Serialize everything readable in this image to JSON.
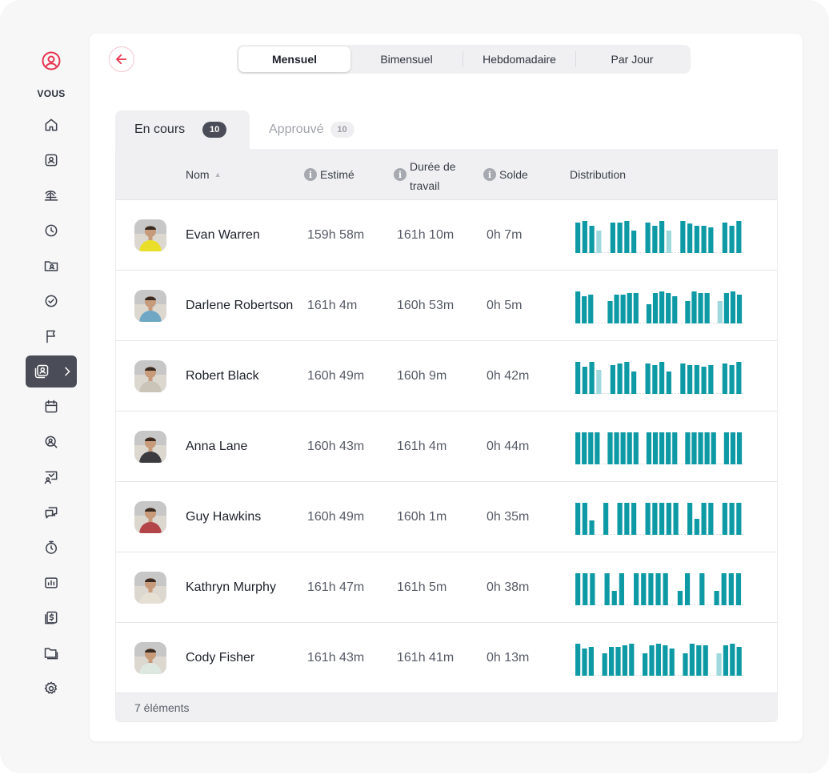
{
  "sidebar": {
    "me_label": "VOUS",
    "items": [
      {
        "icon": "home-icon"
      },
      {
        "icon": "user-card-icon"
      },
      {
        "icon": "beach-icon"
      },
      {
        "icon": "clock-icon"
      },
      {
        "icon": "folder-user-icon"
      },
      {
        "icon": "check-circle-icon"
      },
      {
        "icon": "flag-icon"
      },
      {
        "icon": "timesheet-icon",
        "active": true
      },
      {
        "icon": "calendar-icon"
      },
      {
        "icon": "search-user-icon"
      },
      {
        "icon": "presentation-icon"
      },
      {
        "icon": "chat-icon"
      },
      {
        "icon": "stopwatch-icon"
      },
      {
        "icon": "report-icon"
      },
      {
        "icon": "invoice-icon"
      },
      {
        "icon": "files-icon"
      },
      {
        "icon": "settings-icon"
      }
    ]
  },
  "period": {
    "options": [
      "Mensuel",
      "Bimensuel",
      "Hebdomadaire",
      "Par Jour"
    ],
    "selected": "Mensuel"
  },
  "tabs": [
    {
      "label": "En cours",
      "count": "10",
      "active": true
    },
    {
      "label": "Approuvé",
      "count": "10",
      "active": false
    }
  ],
  "table": {
    "headers": {
      "name": "Nom",
      "estimated": "Estimé",
      "worked": "Durée de travail",
      "balance": "Solde",
      "distribution": "Distribution"
    },
    "rows": [
      {
        "name": "Evan Warren",
        "estimated": "159h 58m",
        "worked": "161h 10m",
        "balance": "0h 7m",
        "avatar_colors": [
          "#e9df2b",
          "#6a4a32"
        ]
      },
      {
        "name": "Darlene Robertson",
        "estimated": "161h 4m",
        "worked": "160h 53m",
        "balance": "0h 5m",
        "avatar_colors": [
          "#6fa7c4",
          "#d9b48f"
        ]
      },
      {
        "name": "Robert Black",
        "estimated": "160h 49m",
        "worked": "160h 9m",
        "balance": "0h 42m",
        "avatar_colors": [
          "#c9c3b8",
          "#8a6a50"
        ]
      },
      {
        "name": "Anna Lane",
        "estimated": "160h 43m",
        "worked": "161h 4m",
        "balance": "0h 44m",
        "avatar_colors": [
          "#3b3b3f",
          "#caa182"
        ]
      },
      {
        "name": "Guy Hawkins",
        "estimated": "160h 49m",
        "worked": "160h 1m",
        "balance": "0h 35m",
        "avatar_colors": [
          "#b34447",
          "#c89a7c"
        ]
      },
      {
        "name": "Kathryn Murphy",
        "estimated": "161h 47m",
        "worked": "161h 5m",
        "balance": "0h 38m",
        "avatar_colors": [
          "#e6e0d4",
          "#d26a6a"
        ]
      },
      {
        "name": "Cody Fisher",
        "estimated": "161h 43m",
        "worked": "161h 41m",
        "balance": "0h 13m",
        "avatar_colors": [
          "#dde8e0",
          "#2a2a2e"
        ]
      }
    ],
    "footer": "7 éléments"
  },
  "distribution_colors": {
    "main": "#0e9aa5",
    "light": "#9fd9dd",
    "baseline": "#d7d9de"
  },
  "distribution": [
    [
      [
        0.95,
        0
      ],
      [
        1,
        0
      ],
      [
        0.85,
        0
      ],
      [
        0.7,
        1
      ],
      null,
      [
        0.95,
        0
      ],
      [
        0.95,
        0
      ],
      [
        1,
        0
      ],
      [
        0.7,
        0
      ],
      null,
      [
        0.95,
        0
      ],
      [
        0.85,
        0
      ],
      [
        1,
        0
      ],
      [
        0.7,
        1
      ],
      null,
      [
        1,
        0
      ],
      [
        0.92,
        0
      ],
      [
        0.85,
        0
      ],
      [
        0.85,
        0
      ],
      [
        0.8,
        0
      ],
      null,
      [
        0.95,
        0
      ],
      [
        0.85,
        0
      ],
      [
        1,
        0
      ]
    ],
    [
      [
        1,
        0
      ],
      [
        0.85,
        0
      ],
      [
        0.9,
        0
      ],
      null,
      null,
      [
        0.7,
        0
      ],
      [
        0.9,
        0
      ],
      [
        0.9,
        0
      ],
      [
        0.95,
        0
      ],
      [
        0.95,
        0
      ],
      null,
      [
        0.6,
        0
      ],
      [
        0.95,
        0
      ],
      [
        1,
        0
      ],
      [
        0.95,
        0
      ],
      [
        0.85,
        0
      ],
      null,
      [
        0.7,
        0
      ],
      [
        1,
        0
      ],
      [
        0.95,
        0
      ],
      [
        0.95,
        0
      ],
      null,
      [
        0.7,
        1
      ],
      [
        0.95,
        0
      ],
      [
        1,
        0
      ],
      [
        0.9,
        0
      ]
    ],
    [
      [
        1,
        0
      ],
      [
        0.85,
        0
      ],
      [
        1,
        0
      ],
      [
        0.75,
        1
      ],
      null,
      [
        0.9,
        0
      ],
      [
        0.95,
        0
      ],
      [
        1,
        0
      ],
      [
        0.7,
        0
      ],
      null,
      [
        0.95,
        0
      ],
      [
        0.9,
        0
      ],
      [
        1,
        0
      ],
      [
        0.7,
        0
      ],
      null,
      [
        0.95,
        0
      ],
      [
        0.9,
        0
      ],
      [
        0.9,
        0
      ],
      [
        0.85,
        0
      ],
      [
        0.9,
        0
      ],
      null,
      [
        0.95,
        0
      ],
      [
        0.9,
        0
      ],
      [
        1,
        0
      ]
    ],
    [
      [
        1,
        0
      ],
      [
        1,
        0
      ],
      [
        1,
        0
      ],
      [
        1,
        0
      ],
      null,
      [
        1,
        0
      ],
      [
        1,
        0
      ],
      [
        1,
        0
      ],
      [
        1,
        0
      ],
      [
        1,
        0
      ],
      null,
      [
        1,
        0
      ],
      [
        1,
        0
      ],
      [
        1,
        0
      ],
      [
        1,
        0
      ],
      [
        1,
        0
      ],
      null,
      [
        1,
        0
      ],
      [
        1,
        0
      ],
      [
        1,
        0
      ],
      [
        1,
        0
      ],
      [
        1,
        0
      ],
      null,
      [
        1,
        0
      ],
      [
        1,
        0
      ],
      [
        1,
        0
      ]
    ],
    [
      [
        1,
        0
      ],
      [
        1,
        0
      ],
      [
        0.45,
        0
      ],
      null,
      [
        1,
        0
      ],
      null,
      [
        1,
        0
      ],
      [
        1,
        0
      ],
      [
        1,
        0
      ],
      null,
      [
        1,
        0
      ],
      [
        1,
        0
      ],
      [
        1,
        0
      ],
      [
        1,
        0
      ],
      [
        1,
        0
      ],
      null,
      [
        1,
        0
      ],
      [
        0.5,
        0
      ],
      [
        1,
        0
      ],
      [
        1,
        0
      ],
      null,
      [
        1,
        0
      ],
      [
        1,
        0
      ],
      [
        1,
        0
      ]
    ],
    [
      [
        1,
        0
      ],
      [
        1,
        0
      ],
      [
        1,
        0
      ],
      null,
      [
        1,
        0
      ],
      [
        0.45,
        0
      ],
      [
        1,
        0
      ],
      null,
      [
        1,
        0
      ],
      [
        1,
        0
      ],
      [
        1,
        0
      ],
      [
        1,
        0
      ],
      [
        1,
        0
      ],
      null,
      [
        0.45,
        0
      ],
      [
        1,
        0
      ],
      null,
      [
        1,
        0
      ],
      null,
      [
        0.45,
        0
      ],
      [
        1,
        0
      ],
      [
        1,
        0
      ],
      [
        1,
        0
      ]
    ],
    [
      [
        1,
        0
      ],
      [
        0.85,
        0
      ],
      [
        0.9,
        0
      ],
      null,
      [
        0.7,
        0
      ],
      [
        0.9,
        0
      ],
      [
        0.9,
        0
      ],
      [
        0.95,
        0
      ],
      [
        1,
        0
      ],
      null,
      [
        0.7,
        0
      ],
      [
        0.95,
        0
      ],
      [
        1,
        0
      ],
      [
        0.95,
        0
      ],
      [
        0.85,
        0
      ],
      null,
      [
        0.7,
        0
      ],
      [
        1,
        0
      ],
      [
        0.95,
        0
      ],
      [
        0.95,
        0
      ],
      null,
      [
        0.7,
        1
      ],
      [
        0.95,
        0
      ],
      [
        1,
        0
      ],
      [
        0.9,
        0
      ]
    ]
  ]
}
